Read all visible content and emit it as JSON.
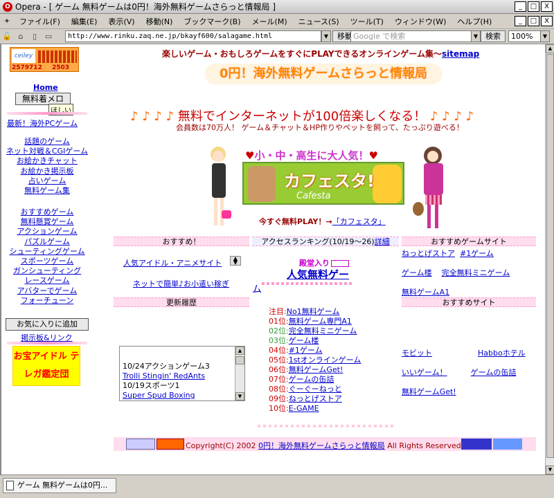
{
  "window": {
    "title": "Opera - [ ゲーム 無料ゲームは0円！海外無料ゲームさらっと情報局 ]",
    "min": "_",
    "max": "□",
    "close": "X"
  },
  "menu": [
    "ファイル(F)",
    "編集(E)",
    "表示(V)",
    "移動(N)",
    "ブックマーク(B)",
    "メール(M)",
    "ニュース(S)",
    "ツール(T)",
    "ウィンドウ(W)",
    "ヘルプ(H)"
  ],
  "address": {
    "url": "http://www.rinku.zaq.ne.jp/bkayf600/salagame.html",
    "go": "移動",
    "search_placeholder": "Google で検索",
    "search_btn": "検索",
    "zoom": "100%"
  },
  "counter": {
    "label": "ceiley",
    "a": "2579712",
    "b": "2503"
  },
  "top_tagline": "楽しいゲーム・おもしろゲームをすぐにPLAYできるオンラインゲーム集〜",
  "sitemap": "sitemap",
  "site_title": "0円！海外無料ゲームさらっと情報局",
  "left_nav": {
    "home": "Home",
    "melody_btn": "無料着メロ",
    "tooltip": "ほしい",
    "newest": "最新！海外PCゲーム",
    "group1": [
      "話題のゲーム",
      "ネット対戦＆CGIゲーム",
      "お絵かきチャット",
      "お絵かき掲示板",
      "占いゲーム",
      "無料ゲーム集"
    ],
    "group2": [
      "おすすめゲーム",
      "無料懸賞ゲーム",
      "アクションゲーム",
      "パズルゲーム",
      "シューティングゲーム",
      "スポーツゲーム",
      "ガンシューティング",
      "レースゲーム",
      "アバターでゲーム",
      "フォーチューン"
    ],
    "fav_btn": "お気に入りに追加",
    "board": "掲示板&リンク",
    "idol_banner": "お宝アイドル テレガ鑑定団"
  },
  "promo": {
    "line1_pre": "♪ ♪ ♪ ♪",
    "line1_text": "無料でインターネットが100倍楽しくなる！",
    "line1_post": "♪ ♪ ♪ ♪",
    "line2": "会員数は70万人！ ゲーム＆チャット＆HP作りやペットを飼って、たっぷり遊べる！",
    "cafe_head": "小・中・高生に大人気！",
    "cafe_title": "カフェスタ!",
    "cafe_sub": "Cafesta",
    "cafe_link_pre": "今すぐ無料PLAY！→",
    "cafe_link": "「カフェスタ」"
  },
  "sections": {
    "recommend": "おすすめ！",
    "ranking": "アクセスランキング(10/19〜26)",
    "ranking_detail": "詳細",
    "rec_sites": "おすすめゲームサイト",
    "updates": "更新履歴",
    "osusume_site": "おすすめサイト"
  },
  "recommend_links": [
    "人気アイドル・アニメサイト",
    "ネットで簡単♪お小遣い稼ぎ"
  ],
  "hall": {
    "label": "殿堂入り",
    "link": "人気無料ゲー",
    "mark": "ム"
  },
  "ranking": [
    {
      "rank": "注目:",
      "name": "No1無料ゲーム"
    },
    {
      "rank": "01位:",
      "name": "無料ゲーム専門A1"
    },
    {
      "rank": "02位:",
      "name": "完全無料ミニゲーム"
    },
    {
      "rank": "03位:",
      "name": "ゲーム楼"
    },
    {
      "rank": "04位:",
      "name": "#1ゲーム"
    },
    {
      "rank": "05位:",
      "name": "1stオンラインゲーム"
    },
    {
      "rank": "06位:",
      "name": "無料ゲームGet!"
    },
    {
      "rank": "07位:",
      "name": "ゲームの缶詰"
    },
    {
      "rank": "08位:",
      "name": "ぐーぐーねっと"
    },
    {
      "rank": "09位:",
      "name": "ねっとげストア"
    },
    {
      "rank": "10位:",
      "name": "E-GAME"
    }
  ],
  "rank_colors": [
    "#c00",
    "#c00",
    "#393",
    "#393",
    "#c00",
    "#c00",
    "#c00",
    "#c00",
    "#c00",
    "#c00",
    "#c00"
  ],
  "site_links": [
    [
      "ねっとげストア",
      "#1ゲーム"
    ],
    [
      "ゲーム楼",
      "完全無料ミニゲーム"
    ],
    [
      "無料ゲームA1",
      ""
    ]
  ],
  "osusume_links": [
    [
      "モビット",
      "Habboホテル"
    ],
    [
      "いいゲーム！",
      "ゲームの缶詰"
    ],
    [
      "無料ゲームGet!",
      ""
    ]
  ],
  "updates": [
    {
      "text": "10/24アクションゲーム3",
      "link": false
    },
    {
      "text": "Trolli Stingin' RedAnts",
      "link": true
    },
    {
      "text": "10/19スポーツ1",
      "link": false
    },
    {
      "text": "Super Spud Boxing",
      "link": true
    }
  ],
  "footer": {
    "copy": "Copyright(C) 2002",
    "site": "0円！海外無料ゲームさらっと情報局",
    "rights": "All Rights Reserved"
  },
  "status_tab": "ゲーム 無料ゲームは0円..."
}
